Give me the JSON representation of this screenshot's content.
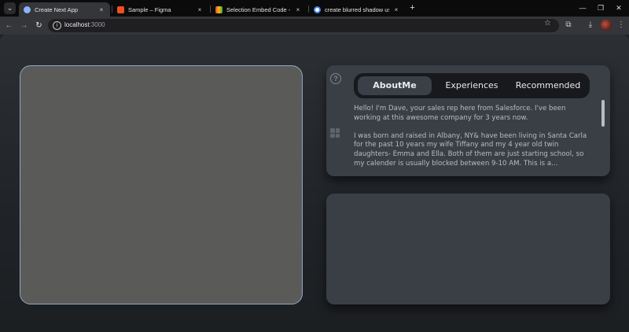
{
  "browser": {
    "tabs": [
      {
        "title": "Create Next App",
        "favicon_color": "#8ab4f8"
      },
      {
        "title": "Sample – Figma",
        "favicon_color": "#f24e1e"
      },
      {
        "title": "Selection Embed Code - Google",
        "favicon_color": "#34a853"
      },
      {
        "title": "create blurred shadow using cs",
        "favicon_color": "#4285f4"
      }
    ],
    "close_glyph": "×",
    "new_tab_glyph": "+",
    "window_controls": [
      "—",
      "❐",
      "✕"
    ],
    "address": {
      "host": "localhost",
      "port": ":3000"
    }
  },
  "profile": {
    "tabs": [
      "AboutMe",
      "Experiences",
      "Recommended"
    ],
    "active_tab": "AboutMe",
    "bio_paragraphs": [
      "Hello! I'm Dave, your sales rep here from Salesforce. I've been working at this awesome company for 3 years now.",
      "I was born and raised in Albany, NY& have been living in Santa Carla for the past 10 years my wife Tiffany and my 4 year old twin daughters- Emma and Ella. Both of them are just starting school, so my calender is usually blocked between 9-10 AM. This is a..."
    ]
  },
  "colors": {
    "page_bg": "#202327",
    "card_bg": "#3a3f46",
    "video_bg": "#5a5a58",
    "video_border": "#8fa9c2",
    "pill_bg": "#17191c"
  }
}
